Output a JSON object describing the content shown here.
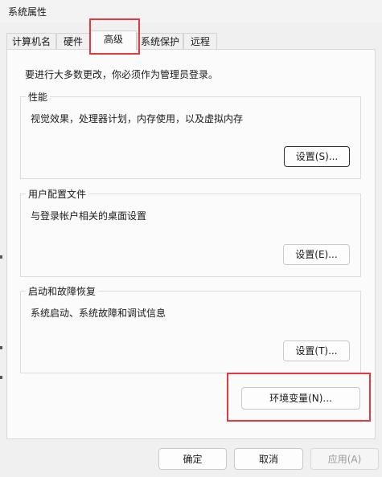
{
  "window": {
    "title": "系统属性"
  },
  "tabs": [
    {
      "label": "计算机名",
      "active": false
    },
    {
      "label": "硬件",
      "active": false
    },
    {
      "label": "高级",
      "active": true
    },
    {
      "label": "系统保护",
      "active": false
    },
    {
      "label": "远程",
      "active": false
    }
  ],
  "advanced": {
    "intro": "要进行大多数更改，你必须作为管理员登录。",
    "performance": {
      "legend": "性能",
      "description": "视觉效果，处理器计划，内存使用，以及虚拟内存",
      "button": "设置(S)..."
    },
    "user_profiles": {
      "legend": "用户配置文件",
      "description": "与登录帐户相关的桌面设置",
      "button": "设置(E)..."
    },
    "startup_recovery": {
      "legend": "启动和故障恢复",
      "description": "系统启动、系统故障和调试信息",
      "button": "设置(T)..."
    },
    "env_button": "环境变量(N)..."
  },
  "footer": {
    "ok": "确定",
    "cancel": "取消",
    "apply": "应用(A)"
  },
  "colors": {
    "highlight": "#e8373d",
    "panel": "#fbfbfb",
    "background": "#f0f0f0"
  }
}
